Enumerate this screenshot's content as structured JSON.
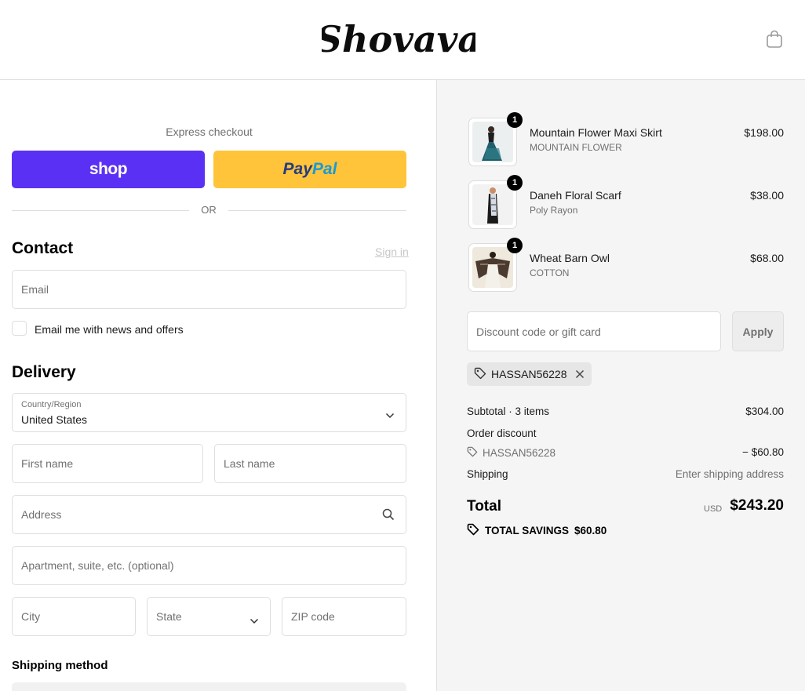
{
  "header": {
    "logo_text": "Shovava",
    "cart_icon": "shopping-bag-icon"
  },
  "express": {
    "label": "Express checkout",
    "shop_label": "shop",
    "paypal_part1": "Pay",
    "paypal_part2": "Pal",
    "or_label": "OR"
  },
  "contact": {
    "heading": "Contact",
    "sign_in": "Sign in",
    "email_placeholder": "Email",
    "newsletter_label": "Email me with news and offers"
  },
  "delivery": {
    "heading": "Delivery",
    "country_label": "Country/Region",
    "country_value": "United States",
    "first_name_placeholder": "First name",
    "last_name_placeholder": "Last name",
    "address_placeholder": "Address",
    "apartment_placeholder": "Apartment, suite, etc. (optional)",
    "city_placeholder": "City",
    "state_placeholder": "State",
    "zip_placeholder": "ZIP code"
  },
  "shipping_method": {
    "heading": "Shipping method"
  },
  "order": {
    "items": [
      {
        "name": "Mountain Flower Maxi Skirt",
        "variant": "MOUNTAIN FLOWER",
        "price": "$198.00",
        "quantity": "1"
      },
      {
        "name": "Daneh Floral Scarf",
        "variant": "Poly Rayon",
        "price": "$38.00",
        "quantity": "1"
      },
      {
        "name": "Wheat Barn Owl",
        "variant": "COTTON",
        "price": "$68.00",
        "quantity": "1"
      }
    ],
    "discount_placeholder": "Discount code or gift card",
    "apply_label": "Apply",
    "applied_code": "HASSAN56228",
    "subtotal_label": "Subtotal · 3 items",
    "subtotal_value": "$304.00",
    "order_discount_label": "Order discount",
    "discount_code": "HASSAN56228",
    "discount_value": "− $60.80",
    "shipping_label": "Shipping",
    "shipping_value": "Enter shipping address",
    "total_label": "Total",
    "total_currency": "USD",
    "total_value": "$243.20",
    "savings_label": "TOTAL SAVINGS",
    "savings_value": "$60.80"
  },
  "colors": {
    "shop_purple": "#5a31f4",
    "paypal_yellow": "#ffc439",
    "summary_bg": "#f5f5f5"
  }
}
